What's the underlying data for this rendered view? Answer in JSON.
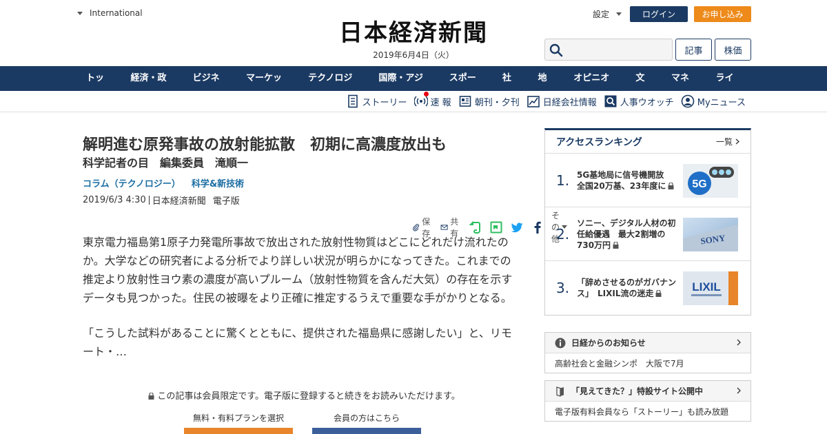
{
  "header": {
    "international": "International",
    "logo": "日本経済新聞",
    "date": "2019年6月4日（火）",
    "settings": "設定",
    "login": "ログイン",
    "apply": "お申し込み",
    "search_placeholder": "",
    "kiji": "記事",
    "kabuka": "株価"
  },
  "nav": {
    "items": [
      "トップ",
      "経済・政治",
      "ビジネス",
      "マーケット",
      "テクノロジー",
      "国際・アジア",
      "スポーツ",
      "社会",
      "地域",
      "オピニオン",
      "文化",
      "マネー",
      "ライフ"
    ]
  },
  "subnav": {
    "items": [
      "ストーリー",
      "速 報",
      "朝刊・夕刊",
      "日経会社情報",
      "人事ウオッチ",
      "Myニュース"
    ]
  },
  "article": {
    "title": "解明進む原発事故の放射能拡散　初期に高濃度放出も",
    "subtitle": "科学記者の目　編集委員　滝順一",
    "tags": [
      "コラム（テクノロジー）",
      "科学&新技術"
    ],
    "datetime": "2019/6/3 4:30",
    "source": "日本経済新聞",
    "edition": "電子版",
    "share": {
      "save": "保存",
      "share": "共有",
      "other": "その他"
    },
    "paragraphs": [
      "東京電力福島第1原子力発電所事故で放出された放射性物質はどこにどれだけ流れたのか。大学などの研究者による分析でより詳しい状況が明らかになってきた。これまでの推定より放射性ヨウ素の濃度が高いプルーム（放射性物質を含んだ大気）の存在を示すデータも見つかった。住民の被曝をより正確に推定するうえで重要な手がかりとなる。",
      "「こうした試料があることに驚くとともに、提供された福島県に感謝したい」と、リモート・…"
    ],
    "members_notice": "この記事は会員限定です。電子版に登録すると続きをお読みいただけます。",
    "plan_label": "無料・有料プランを選択",
    "member_label": "会員の方はこちら"
  },
  "sidebar": {
    "ranking_title": "アクセスランキング",
    "ranking_more": "一覧",
    "ranking": [
      {
        "num": "1.",
        "text": "5G基地局に信号機開放　全国20万基、23年度に",
        "thumb_label": "5G"
      },
      {
        "num": "2.",
        "text": "ソニー、デジタル人材の初任給優遇　最大2割増の730万円",
        "thumb_label": "SONY"
      },
      {
        "num": "3.",
        "text": "「辞めさせるのがガバナンス」　LIXIL流の迷走",
        "thumb_label": "LIXIL"
      }
    ],
    "notice_title": "日経からのお知らせ",
    "notice_body": "高齢社会と金融シンポ　大阪で7月",
    "special_title": "「見えてきた？」特設サイト公開中",
    "special_body": "電子版有料会員なら「ストーリー」も読み放題"
  },
  "colors": {
    "navy": "#1b3a63",
    "orange": "#ed8a1a",
    "link_blue": "#1b6ea3",
    "plan_orange": "#e8852a",
    "member_blue": "#3b5f9a"
  }
}
